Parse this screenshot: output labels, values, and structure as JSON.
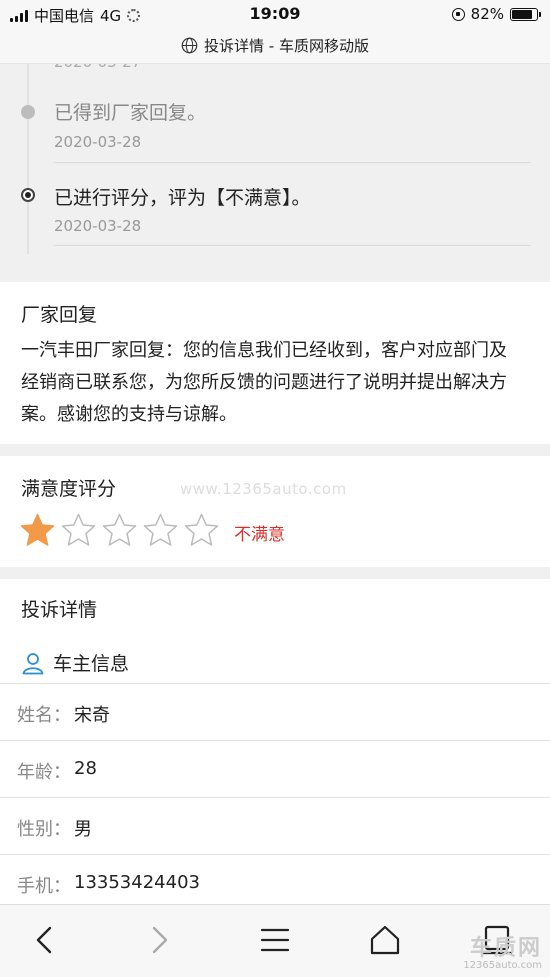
{
  "status_bar": {
    "carrier": "中国电信",
    "network": "4G",
    "time": "19:09",
    "battery": "82%",
    "battery_level": 0.82
  },
  "address_bar": {
    "title": "投诉详情 - 车质网移动版"
  },
  "timeline": {
    "partial_text": "2020-03-27",
    "items": [
      {
        "text": "已得到厂家回复。",
        "date": "2020-03-28"
      },
      {
        "text": "已进行评分，评为【不满意】。",
        "date": "2020-03-28"
      }
    ]
  },
  "reply": {
    "title": "厂家回复",
    "lines": [
      "一汽丰田厂家回复：您的信息我们已经收到，客户对应部门及",
      "经销商已联系您，为您所反馈的问题进行了说明并提出解决方",
      "案。感谢您的支持与谅解。"
    ]
  },
  "satisfaction": {
    "title": "满意度评分",
    "watermark": "www.12365auto.com",
    "rating": 1,
    "max_rating": 5,
    "label": "不满意",
    "star_color": "#f39a4a",
    "label_color": "#d6322a"
  },
  "details": {
    "title": "投诉详情",
    "owner_heading": "车主信息",
    "rows": [
      {
        "label": "姓名：",
        "value": "宋奇"
      },
      {
        "label": "年龄：",
        "value": "28"
      },
      {
        "label": "性别：",
        "value": "男"
      },
      {
        "label": "手机：",
        "value": "13353424403"
      }
    ]
  },
  "bottom_bar": {
    "icons": [
      "back-icon",
      "forward-icon",
      "menu-icon",
      "home-icon",
      "tabs-icon"
    ],
    "brand_name": "车质网",
    "brand_url": "12365auto.com"
  }
}
